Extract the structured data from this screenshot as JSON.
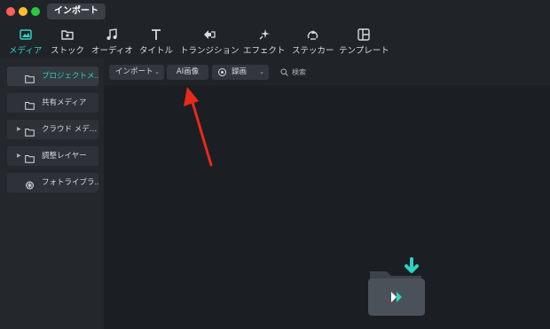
{
  "window": {
    "tab_title": "インポート"
  },
  "toolbar": {
    "items": [
      {
        "label": "メディア",
        "icon": "media-icon",
        "active": true
      },
      {
        "label": "ストック",
        "icon": "stock-icon"
      },
      {
        "label": "オーディオ",
        "icon": "audio-icon"
      },
      {
        "label": "タイトル",
        "icon": "title-icon"
      },
      {
        "label": "トランジション",
        "icon": "transition-icon"
      },
      {
        "label": "エフェクト",
        "icon": "effect-icon"
      },
      {
        "label": "ステッカー",
        "icon": "sticker-icon"
      },
      {
        "label": "テンプレート",
        "icon": "template-icon"
      }
    ]
  },
  "sidebar": {
    "items": [
      {
        "label": "プロジェクトメ…",
        "icon": "folder-icon",
        "active": true
      },
      {
        "label": "共有メディア",
        "icon": "folder-icon"
      },
      {
        "label": "クラウド メデ…",
        "icon": "folder-icon",
        "expandable": true
      },
      {
        "label": "調整レイヤー",
        "icon": "folder-icon",
        "expandable": true
      },
      {
        "label": "フォトライブラ…",
        "icon": "photo-library-icon"
      }
    ]
  },
  "subbar": {
    "import_label": "インポート",
    "ai_image_label": "AI画像",
    "record_label": "録画",
    "search_placeholder": "検索"
  },
  "colors": {
    "accent": "#2fd2c2",
    "annotation_arrow": "#e8291c"
  }
}
